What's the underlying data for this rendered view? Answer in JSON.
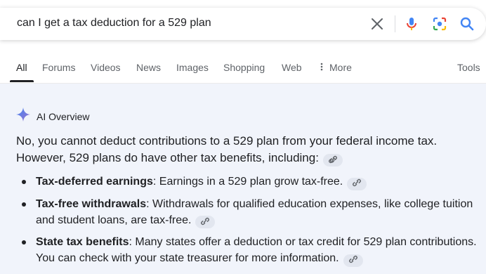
{
  "search": {
    "query": "can I get a tax deduction for a 529 plan"
  },
  "icons": {
    "clear": "close-icon",
    "mic": "mic-icon",
    "lens": "camera-lens-icon",
    "search": "search-icon",
    "more": "vertical-dots-icon",
    "sparkle": "sparkle-icon",
    "link": "link-icon"
  },
  "colors": {
    "accent_blue": "#4285f4",
    "panel_background": "#f1f4fb"
  },
  "tabs": [
    {
      "label": "All",
      "active": true
    },
    {
      "label": "Forums"
    },
    {
      "label": "Videos"
    },
    {
      "label": "News"
    },
    {
      "label": "Images"
    },
    {
      "label": "Shopping"
    },
    {
      "label": "Web"
    },
    {
      "label": "More"
    },
    {
      "label": "Tools"
    }
  ],
  "ai_overview": {
    "title": "AI Overview",
    "summary": "No, you cannot deduct contributions to a 529 plan from your federal income tax. However, 529 plans do have other tax benefits, including:",
    "items": [
      {
        "term": "Tax-deferred earnings",
        "text": ": Earnings in a 529 plan grow tax-free."
      },
      {
        "term": "Tax-free withdrawals",
        "text": ": Withdrawals for qualified education expenses, like college tuition and student loans, are tax-free."
      },
      {
        "term": "State tax benefits",
        "text": ": Many states offer a deduction or tax credit for 529 plan contributions. You can check with your state treasurer for more information."
      }
    ]
  }
}
